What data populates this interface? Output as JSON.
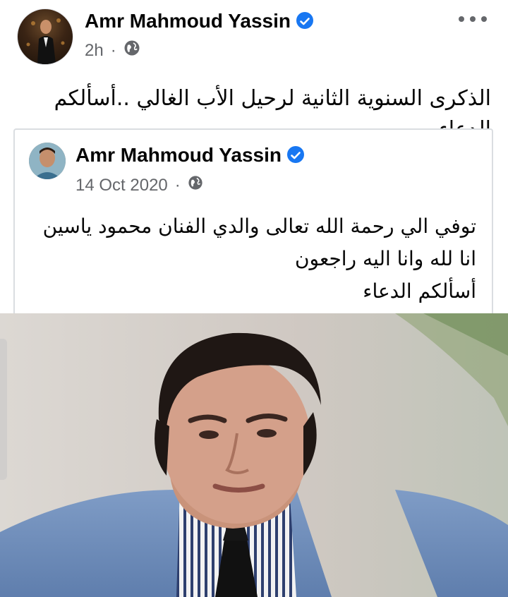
{
  "post": {
    "author": "Amr Mahmoud Yassin",
    "time": "2h",
    "text": "الذكرى السنوية الثانية لرحيل الأب الغالي ..أسألكم الدعاء"
  },
  "shared_post": {
    "author": "Amr Mahmoud Yassin",
    "date": "14 Oct 2020",
    "lines": [
      "توفي الي رحمة  الله تعالى والدي الفنان محمود ياسين",
      "انا لله وانا اليه راجعون",
      "أسألكم  الدعاء"
    ]
  },
  "colors": {
    "verified": "#1877f2",
    "meta_text": "#65676b",
    "border": "#dadde1"
  },
  "icons": {
    "privacy": "globe-icon",
    "verified": "verified-badge-icon",
    "more": "more-options-icon"
  }
}
